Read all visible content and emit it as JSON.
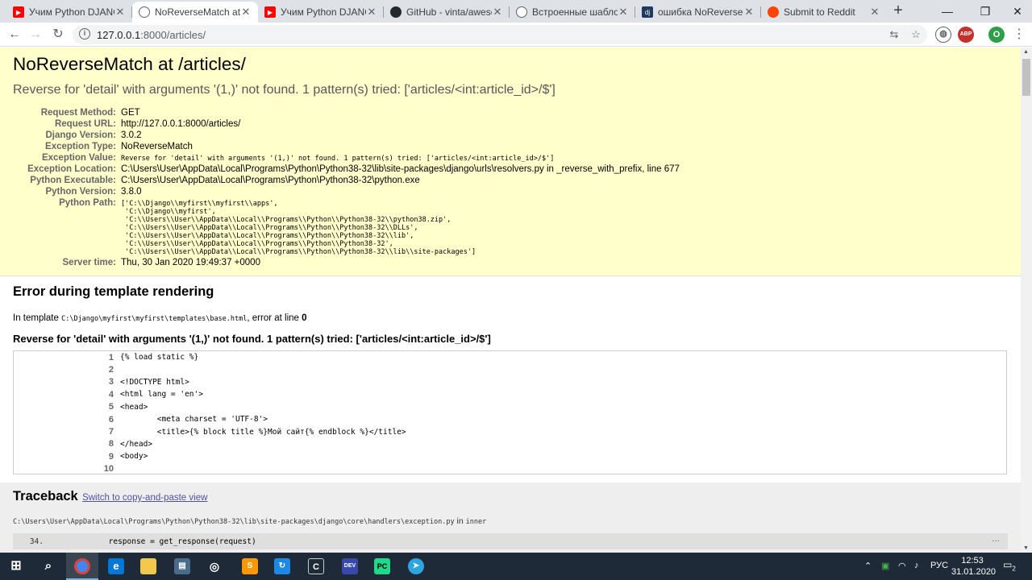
{
  "browser": {
    "tabs": [
      {
        "title": "Учим Python DJANGO",
        "icon": "youtube-icon"
      },
      {
        "title": "NoReverseMatch at /articles/",
        "icon": "globe-icon",
        "active": true
      },
      {
        "title": "Учим Python DJANGO",
        "icon": "youtube-icon"
      },
      {
        "title": "GitHub - vinta/awesome-python",
        "icon": "github-icon"
      },
      {
        "title": "Встроенные шаблонные теги",
        "icon": "globe-icon"
      },
      {
        "title": "ошибка NoReverseMatch",
        "icon": "django-icon"
      },
      {
        "title": "Submit to Reddit",
        "icon": "reddit-icon"
      }
    ],
    "url_host": "127.0.0.1",
    "url_rest": ":8000/articles/",
    "profile_initial": "O",
    "abp_label": "ABP"
  },
  "summary": {
    "title": "NoReverseMatch at /articles/",
    "exception": "Reverse for 'detail' with arguments '(1,)' not found. 1 pattern(s) tried: ['articles/<int:article_id>/$']",
    "rows": [
      {
        "label": "Request Method:",
        "value": "GET"
      },
      {
        "label": "Request URL:",
        "value": "http://127.0.0.1:8000/articles/"
      },
      {
        "label": "Django Version:",
        "value": "3.0.2"
      },
      {
        "label": "Exception Type:",
        "value": "NoReverseMatch"
      },
      {
        "label": "Exception Value:",
        "value": "Reverse for 'detail' with arguments '(1,)' not found. 1 pattern(s) tried: ['articles/<int:article_id>/$']"
      },
      {
        "label": "Exception Location:",
        "value": "C:\\Users\\User\\AppData\\Local\\Programs\\Python\\Python38-32\\lib\\site-packages\\django\\urls\\resolvers.py in _reverse_with_prefix, line 677"
      },
      {
        "label": "Python Executable:",
        "value": "C:\\Users\\User\\AppData\\Local\\Programs\\Python\\Python38-32\\python.exe"
      },
      {
        "label": "Python Version:",
        "value": "3.8.0"
      },
      {
        "label": "Python Path:",
        "value": "['C:\\\\Django\\\\myfirst\\\\myfirst\\\\apps',\n 'C:\\\\Django\\\\myfirst',\n 'C:\\\\Users\\\\User\\\\AppData\\\\Local\\\\Programs\\\\Python\\\\Python38-32\\\\python38.zip',\n 'C:\\\\Users\\\\User\\\\AppData\\\\Local\\\\Programs\\\\Python\\\\Python38-32\\\\DLLs',\n 'C:\\\\Users\\\\User\\\\AppData\\\\Local\\\\Programs\\\\Python\\\\Python38-32\\\\lib',\n 'C:\\\\Users\\\\User\\\\AppData\\\\Local\\\\Programs\\\\Python\\\\Python38-32',\n 'C:\\\\Users\\\\User\\\\AppData\\\\Local\\\\Programs\\\\Python\\\\Python38-32\\\\lib\\\\site-packages']"
      },
      {
        "label": "Server time:",
        "value": "Thu, 30 Jan 2020 19:49:37 +0000"
      }
    ]
  },
  "template_error": {
    "heading": "Error during template rendering",
    "in_template_prefix": "In template ",
    "template_path": "C:\\Django\\myfirst\\myfirst\\templates\\base.html",
    "error_at_line_text": ", error at line ",
    "error_line": "0",
    "message": "Reverse for 'detail' with arguments '(1,)' not found. 1 pattern(s) tried: ['articles/<int:article_id>/$']",
    "source_lines": [
      {
        "n": "1",
        "code": "{% load static %}"
      },
      {
        "n": "2",
        "code": ""
      },
      {
        "n": "3",
        "code": "<!DOCTYPE html>"
      },
      {
        "n": "4",
        "code": "<html lang = 'en'>"
      },
      {
        "n": "5",
        "code": "<head>"
      },
      {
        "n": "6",
        "code": "        <meta charset = 'UTF-8'>"
      },
      {
        "n": "7",
        "code": "        <title>{% block title %}Мой сайт{% endblock %}</title>"
      },
      {
        "n": "8",
        "code": "</head>"
      },
      {
        "n": "9",
        "code": "<body>"
      },
      {
        "n": "10",
        "code": ""
      }
    ]
  },
  "traceback": {
    "heading": "Traceback",
    "switch_link": "Switch to copy-and-paste view",
    "frame_file": "C:\\Users\\User\\AppData\\Local\\Programs\\Python\\Python38-32\\lib\\site-packages\\django\\core\\handlers\\exception.py",
    "frame_in": " in ",
    "frame_func": "inner",
    "context_line_no": "34.",
    "context_line_code": "            response = get_response(request)",
    "more": "…"
  },
  "taskbar": {
    "tray_lang": "РУС",
    "time": "12:53",
    "date": "31.01.2020",
    "notif_count": "2"
  }
}
